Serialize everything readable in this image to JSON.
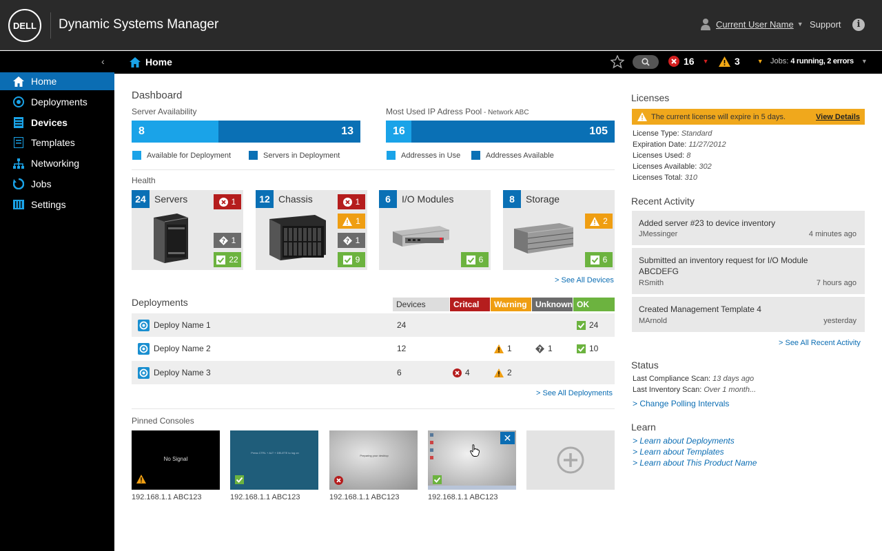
{
  "app": {
    "brand": "DELL",
    "title": "Dynamic Systems Manager"
  },
  "header": {
    "user_name": "Current User Name",
    "support_label": "Support"
  },
  "sidebar": {
    "items": [
      {
        "label": "Home",
        "icon": "home-icon",
        "active": true
      },
      {
        "label": "Deployments",
        "icon": "deployments-icon"
      },
      {
        "label": "Devices",
        "icon": "devices-icon"
      },
      {
        "label": "Templates",
        "icon": "templates-icon"
      },
      {
        "label": "Networking",
        "icon": "networking-icon"
      },
      {
        "label": "Jobs",
        "icon": "jobs-icon"
      },
      {
        "label": "Settings",
        "icon": "settings-icon"
      }
    ]
  },
  "crumb": {
    "label": "Home",
    "errors": "16",
    "warnings": "3",
    "jobs_label": "Jobs:",
    "jobs_value": "4 running, 2 errors"
  },
  "dashboard": {
    "title": "Dashboard",
    "availability": {
      "title": "Server Availability",
      "available": "8",
      "in_deployment": "13",
      "available_fraction": 0.38,
      "legend_a": "Available for Deployment",
      "legend_b": "Servers in Deployment"
    },
    "ip_pool": {
      "title": "Most Used IP Adress Pool",
      "network": " - Network ABC",
      "in_use": "16",
      "available": "105",
      "in_use_fraction": 0.11,
      "legend_a": "Addresses in Use",
      "legend_b": "Addresses Available"
    },
    "health": {
      "title": "Health",
      "cards": [
        {
          "count": "24",
          "name": "Servers",
          "critical": "1",
          "unknown": "1",
          "ok": "22"
        },
        {
          "count": "12",
          "name": "Chassis",
          "critical": "1",
          "warning": "1",
          "unknown": "1",
          "ok": "9"
        },
        {
          "count": "6",
          "name": "I/O Modules",
          "ok": "6"
        },
        {
          "count": "8",
          "name": "Storage",
          "warning": "2",
          "ok": "6"
        }
      ],
      "see_all": "> See All Devices"
    },
    "deployments": {
      "title": "Deployments",
      "columns": [
        "Devices",
        "Critcal",
        "Warning",
        "Unknown",
        "OK"
      ],
      "rows": [
        {
          "name": "Deploy Name 1",
          "devices": "24",
          "critical": "",
          "warning": "",
          "unknown": "",
          "ok": "24"
        },
        {
          "name": "Deploy Name 2",
          "devices": "12",
          "critical": "",
          "warning": "1",
          "unknown": "1",
          "ok": "10"
        },
        {
          "name": "Deploy Name 3",
          "devices": "6",
          "critical": "4",
          "warning": "2",
          "unknown": "",
          "ok": ""
        }
      ],
      "see_all": "> See All Deployments"
    },
    "pinned": {
      "title": "Pinned Consoles",
      "consoles": [
        {
          "caption": "192.168.1.1 ABC123",
          "screen_text": "No Signal",
          "status": "warning"
        },
        {
          "caption": "192.168.1.1 ABC123",
          "screen_text": "Press CTRL + ALT + DELETE to log on",
          "status": "ok"
        },
        {
          "caption": "192.168.1.1 ABC123",
          "screen_text": "Preparing your desktop",
          "status": "critical"
        },
        {
          "caption": "192.168.1.1 ABC123",
          "screen_text": "",
          "status": "ok"
        }
      ]
    }
  },
  "licenses": {
    "title": "Licenses",
    "alert": "The current license will expire in 5 days.",
    "alert_link": "View Details",
    "lines": [
      {
        "label": "License Type: ",
        "value": "Standard"
      },
      {
        "label": "Expiration Date: ",
        "value": "11/27/2012"
      },
      {
        "label": "Licenses Used: ",
        "value": "8"
      },
      {
        "label": "Licenses Available: ",
        "value": "302"
      },
      {
        "label": "Licenses Total: ",
        "value": "310"
      }
    ]
  },
  "activity": {
    "title": "Recent Activity",
    "items": [
      {
        "text": "Added server #23 to device inventory",
        "user": "JMessinger",
        "when": "4 minutes ago"
      },
      {
        "text": "Submitted an inventory request for I/O Module ABCDEFG",
        "user": "RSmith",
        "when": "7 hours ago"
      },
      {
        "text": "Created Management Template 4",
        "user": "MArnold",
        "when": "yesterday"
      }
    ],
    "see_all": "> See All Recent Activity"
  },
  "status": {
    "title": "Status",
    "lines": [
      {
        "label": "Last Compliance Scan: ",
        "value": "13 days ago"
      },
      {
        "label": "Last Inventory Scan: ",
        "value": "Over 1 month..."
      }
    ],
    "link": "> Change Polling Intervals"
  },
  "learn": {
    "title": "Learn",
    "links": [
      "> Learn about Deployments",
      "> Learn about Templates",
      "> Learn about This Product Name"
    ]
  },
  "colors": {
    "accent": "#0b6db3",
    "light_blue": "#1aa3e8",
    "critical": "#b51d1d",
    "warning": "#ef9e12",
    "unknown": "#6b6b6b",
    "ok": "#6cb33f"
  }
}
